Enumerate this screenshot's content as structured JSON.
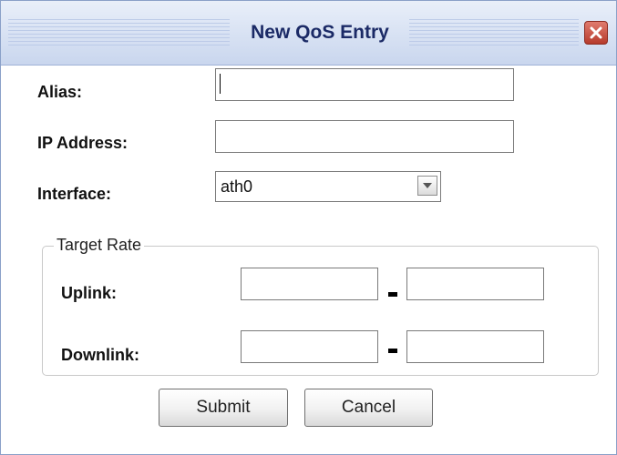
{
  "dialog": {
    "title": "New QoS Entry",
    "close_icon": "close-icon"
  },
  "form": {
    "alias": {
      "label": "Alias:",
      "value": ""
    },
    "ip_address": {
      "label": "IP Address:",
      "value": ""
    },
    "interface": {
      "label": "Interface:",
      "value": "ath0",
      "icon": "chevron-down-icon"
    }
  },
  "target_rate": {
    "legend": "Target Rate",
    "uplink": {
      "label": "Uplink:",
      "from": "",
      "to": ""
    },
    "downlink": {
      "label": "Downlink:",
      "from": "",
      "to": ""
    }
  },
  "buttons": {
    "submit": "Submit",
    "cancel": "Cancel"
  },
  "colors": {
    "title_text": "#1b2a66",
    "titlebar_top": "#e9eff9",
    "titlebar_bottom": "#c9d6ee",
    "close_button": "#b63a2c"
  }
}
